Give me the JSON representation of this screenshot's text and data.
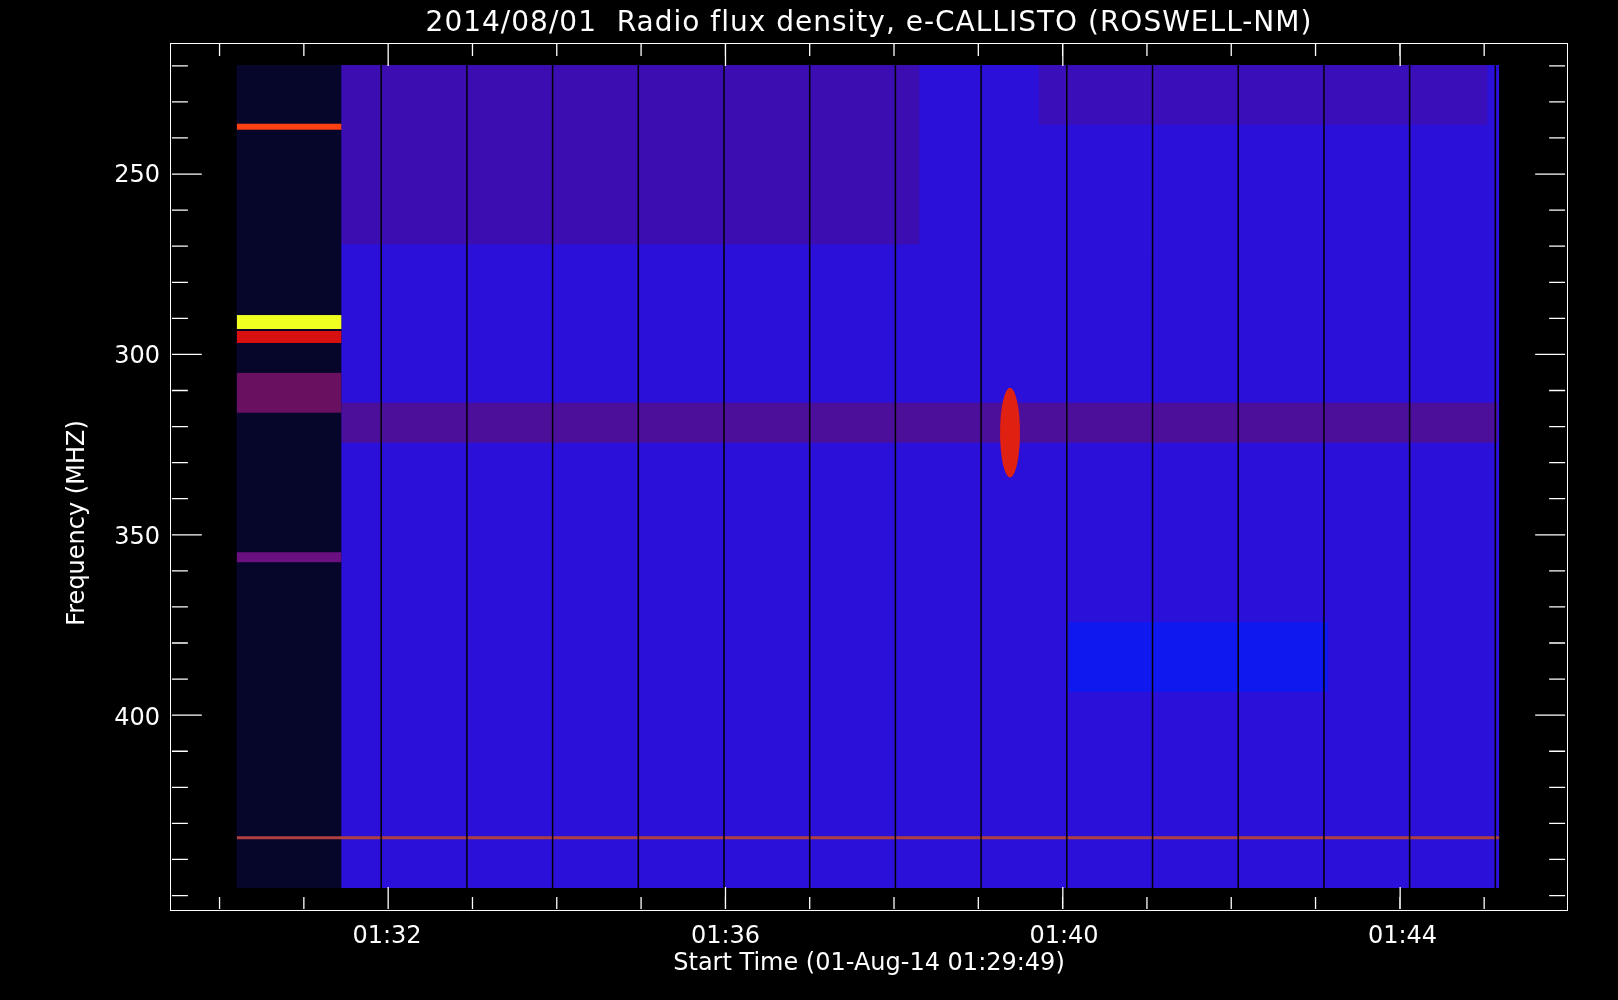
{
  "title": "2014/08/01  Radio flux density, e-CALLISTO (ROSWELL-NM)",
  "y_axis": {
    "label": "Frequency (MHZ)",
    "ticks": [
      "250",
      "300",
      "350",
      "400"
    ]
  },
  "x_axis": {
    "label": "Start Time (01-Aug-14 01:29:49)",
    "ticks": [
      "01:32",
      "01:36",
      "01:40",
      "01:44"
    ]
  }
}
